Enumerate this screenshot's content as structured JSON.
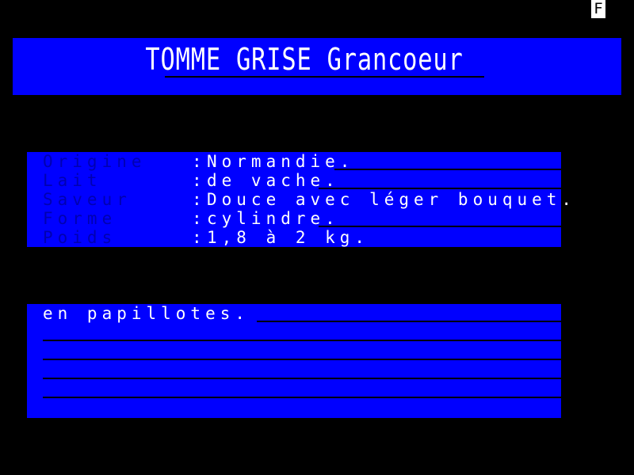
{
  "page_indicator": "F",
  "title": "TOMME GRISE Grancoeur",
  "details": [
    {
      "label": "Origine",
      "value": "Normandie."
    },
    {
      "label": "Lait",
      "value": "de vache."
    },
    {
      "label": "Saveur",
      "value": "Douce avec léger bouquet."
    },
    {
      "label": "Forme",
      "value": "cylindre."
    },
    {
      "label": "Poids",
      "value": "1,8 à 2 kg."
    }
  ],
  "notes": [
    "en papillotes."
  ],
  "colors": {
    "background": "#000000",
    "band": "#0000ff",
    "label": "#0000b0",
    "text": "#ffffff"
  }
}
